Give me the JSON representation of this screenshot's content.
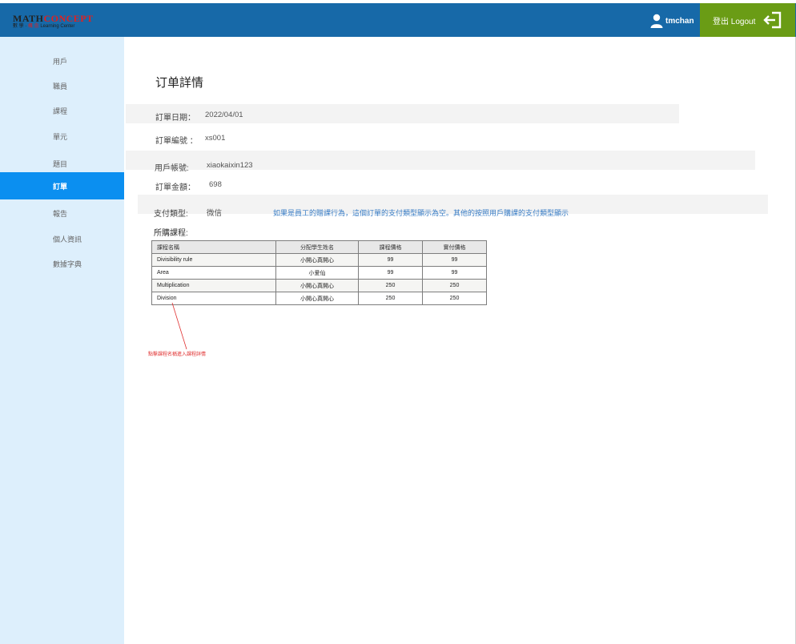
{
  "header": {
    "logo": {
      "main_first": "MATH",
      "main_second": "CONCEPT",
      "sub_prefix": "數 學 · ",
      "sub_red": "概 念",
      "sub_suffix": " Learning Center"
    },
    "username": "tmchan",
    "logout_label": "登出 Logout",
    "colors": {
      "bar": "#1769a8",
      "logout_bg": "#6a9c15"
    }
  },
  "sidebar": {
    "items": [
      {
        "label": "用戶",
        "active": false
      },
      {
        "label": "職員",
        "active": false
      },
      {
        "label": "課程",
        "active": false
      },
      {
        "label": "單元",
        "active": false
      },
      {
        "label": "題目",
        "active": false
      },
      {
        "label": "訂單",
        "active": true
      },
      {
        "label": "報告",
        "active": false
      },
      {
        "label": "個人資訊",
        "active": false
      },
      {
        "label": "數據字典",
        "active": false
      }
    ],
    "colors": {
      "bg": "#ddeffc",
      "active_bg": "#0b8ff0"
    }
  },
  "main": {
    "title": "订单詳情",
    "fields": {
      "order_date": {
        "label": "訂單日期：",
        "value": "2022/04/01"
      },
      "order_no": {
        "label": "訂單編號 ：",
        "value": "xs001"
      },
      "user_account": {
        "label": "用戶帳號:",
        "value": "xiaokaixin123"
      },
      "amount": {
        "label": "訂單金額：",
        "value": "698"
      },
      "payment_type": {
        "label": "支付類型:",
        "value": "微信",
        "note": "如果是員工的贈課行為，這個訂單的支付類型顯示為空。其他的按照用戶購課的支付類型顯示"
      }
    },
    "courses_label": "所購課程:",
    "table": {
      "headers": [
        "課程名稱",
        "分配學生姓名",
        "課程價格",
        "實付價格"
      ],
      "rows": [
        [
          "Divisibility rule",
          "小開心真開心",
          "99",
          "99"
        ],
        [
          "Area",
          "小爱仙",
          "99",
          "99"
        ],
        [
          "Multiplication",
          "小開心真開心",
          "250",
          "250"
        ],
        [
          "Division",
          "小開心真開心",
          "250",
          "250"
        ]
      ]
    },
    "annotation": "點擊課程名稱進入課程詳情",
    "colors": {
      "note": "#3a7ec6",
      "annotation": "#e03030"
    }
  }
}
